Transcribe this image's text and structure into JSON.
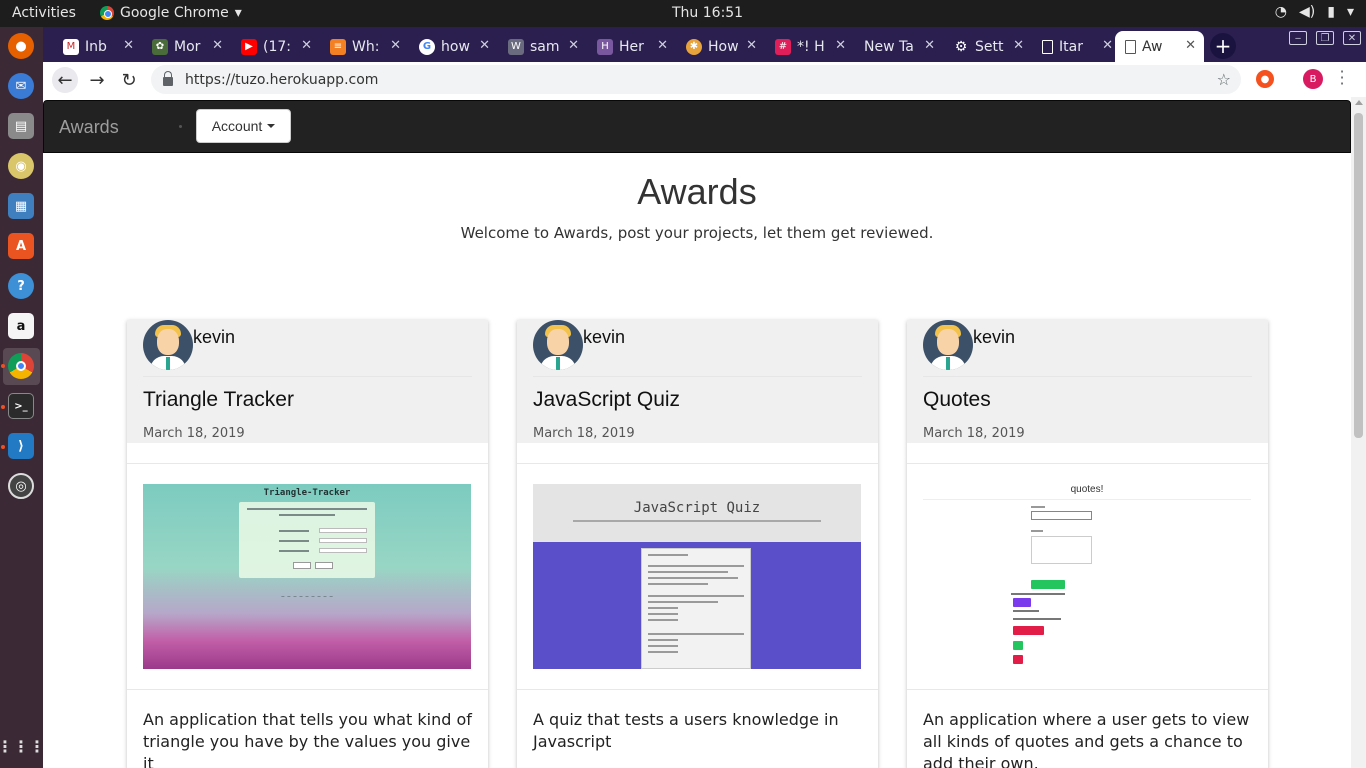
{
  "os": {
    "activities": "Activities",
    "app_name": "Google Chrome",
    "clock": "Thu 16:51"
  },
  "browser": {
    "tabs": [
      {
        "label": "Inb",
        "icon": "gmail-icon",
        "color": "#c62828"
      },
      {
        "label": "Mor",
        "icon": "plant-icon",
        "color": "#4a6b3a"
      },
      {
        "label": "(17:",
        "icon": "youtube-icon",
        "color": "#ff0000"
      },
      {
        "label": "Wh:",
        "icon": "stackoverflow-icon",
        "color": "#f48024"
      },
      {
        "label": "how",
        "icon": "google-icon",
        "color": "#4285f4"
      },
      {
        "label": "sam",
        "icon": "w3schools-icon",
        "color": "#6b6b80"
      },
      {
        "label": "Her",
        "icon": "heroku-icon",
        "color": "#79589f"
      },
      {
        "label": "How",
        "icon": "slack-colorful-icon",
        "color": "#e8a33d"
      },
      {
        "label": "*! H",
        "icon": "slack-icon",
        "color": "#e01e5a"
      },
      {
        "label": "New Ta",
        "icon": "",
        "color": ""
      },
      {
        "label": "Sett",
        "icon": "gear-icon",
        "color": "#ffffff"
      },
      {
        "label": "Itar",
        "icon": "document-icon",
        "color": "#ffffff"
      },
      {
        "label": "Aw",
        "icon": "document-icon",
        "color": "#555555"
      }
    ],
    "url": "https://tuzo.herokuapp.com",
    "profile_initial": "B"
  },
  "site": {
    "brand": "Awards",
    "account_label": "Account",
    "hero_title": "Awards",
    "hero_subtitle": "Welcome to Awards, post your projects, let them get reviewed."
  },
  "image_text": {
    "triangle_heading": "Triangle-Tracker",
    "quiz_heading": "JavaScript Quiz",
    "quotes_heading": "quotes!"
  },
  "projects": [
    {
      "user": "kevin",
      "title": "Triangle Tracker",
      "date": "March 18, 2019",
      "description": "An application that tells you what kind of triangle you have by the values you give it"
    },
    {
      "user": "kevin",
      "title": "JavaScript Quiz",
      "date": "March 18, 2019",
      "description": "A quiz that tests a users knowledge in Javascript"
    },
    {
      "user": "kevin",
      "title": "Quotes",
      "date": "March 18, 2019",
      "description": "An application where a user gets to view all kinds of quotes and gets a chance to add their own."
    }
  ]
}
